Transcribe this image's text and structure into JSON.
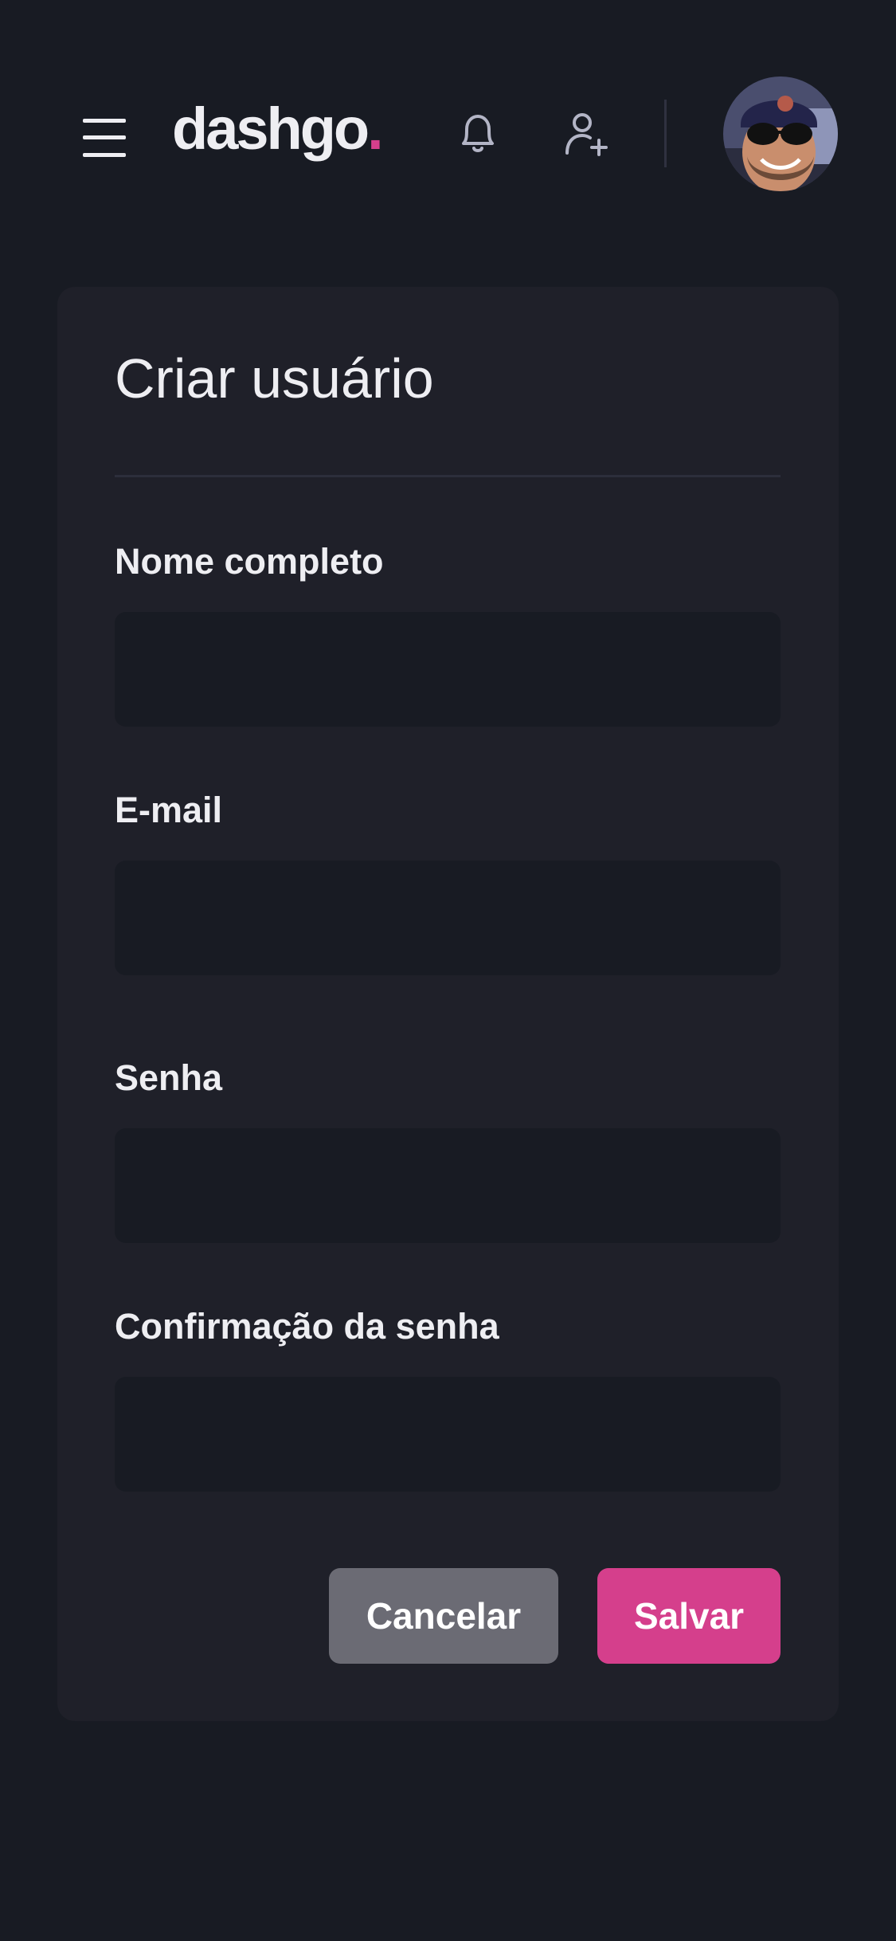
{
  "header": {
    "logo_text": "dashgo",
    "logo_dot": ".",
    "accent_color": "#d53f8c",
    "icons": {
      "menu": "menu-icon",
      "notifications": "bell-icon",
      "add_user": "user-plus-icon",
      "avatar": "avatar"
    }
  },
  "form": {
    "title": "Criar usuário",
    "fields": [
      {
        "label": "Nome completo",
        "value": "",
        "placeholder": ""
      },
      {
        "label": "E-mail",
        "value": "",
        "placeholder": ""
      },
      {
        "label": "Senha",
        "value": "",
        "placeholder": ""
      },
      {
        "label": "Confirmação da senha",
        "value": "",
        "placeholder": ""
      }
    ],
    "cancel_label": "Cancelar",
    "save_label": "Salvar"
  }
}
